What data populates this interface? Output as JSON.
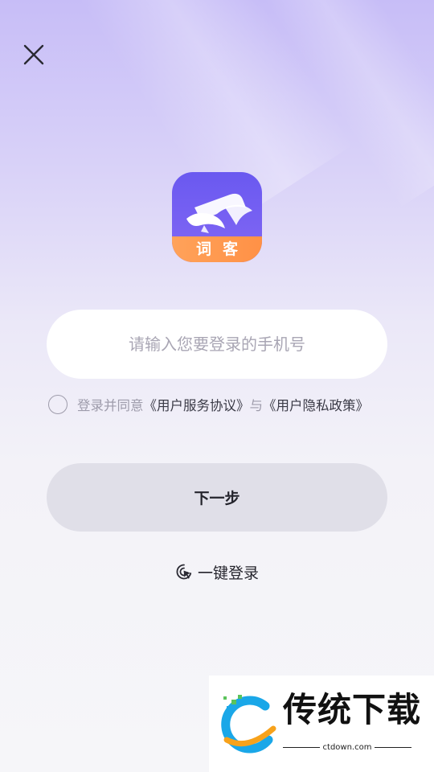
{
  "app": {
    "logo_label": "词客"
  },
  "login": {
    "phone_placeholder": "请输入您要登录的手机号",
    "agree_prefix": "登录并同意",
    "user_agreement": "《用户服务协议》",
    "and_word": "与",
    "privacy_policy": "《用户隐私政策》",
    "next_label": "下一步",
    "one_key_label": "一键登录"
  },
  "watermark": {
    "brand": "传统下载",
    "url": "ctdown.com"
  },
  "colors": {
    "accent": "#6a59f0",
    "logo_band": "#ffa25a",
    "button_bg": "#e0dfe8"
  },
  "icons": {
    "close": "close-icon",
    "one_key": "touch-pointer-icon"
  }
}
